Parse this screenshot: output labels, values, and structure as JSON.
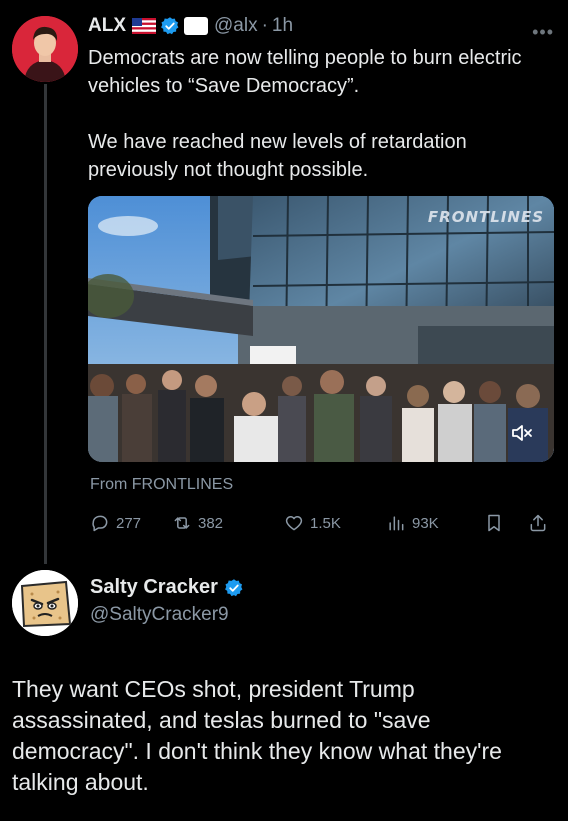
{
  "tweet": {
    "author_name": "ALX",
    "handle": "@alx",
    "separator": "·",
    "time": "1h",
    "affiliate_badge_text": "",
    "text_line1": "Democrats are now telling people to burn electric vehicles to “Save Democracy”.",
    "text_line2": "We have reached new levels of retardation previously not thought possible.",
    "media": {
      "watermark": "FRONTLINES"
    },
    "from_label": "From FRONTLINES",
    "stats": {
      "replies": "277",
      "reposts": "382",
      "likes": "1.5K",
      "views": "93K"
    }
  },
  "reply": {
    "author_name": "Salty Cracker",
    "handle": "@SaltyCracker9",
    "text": "They want CEOs shot, president Trump assassinated, and teslas burned to \"save democracy\". I don't think they know what they're talking about."
  },
  "colors": {
    "background": "#000000",
    "text": "#e7e9ea",
    "muted": "#8b98a5",
    "verified": "#1d9bf0",
    "thread_line": "#333639"
  },
  "icons": {
    "more": "more-icon",
    "reply": "reply-icon",
    "repost": "repost-icon",
    "like": "heart-icon",
    "views": "views-icon",
    "bookmark": "bookmark-icon",
    "share": "share-icon",
    "mute": "mute-icon"
  }
}
